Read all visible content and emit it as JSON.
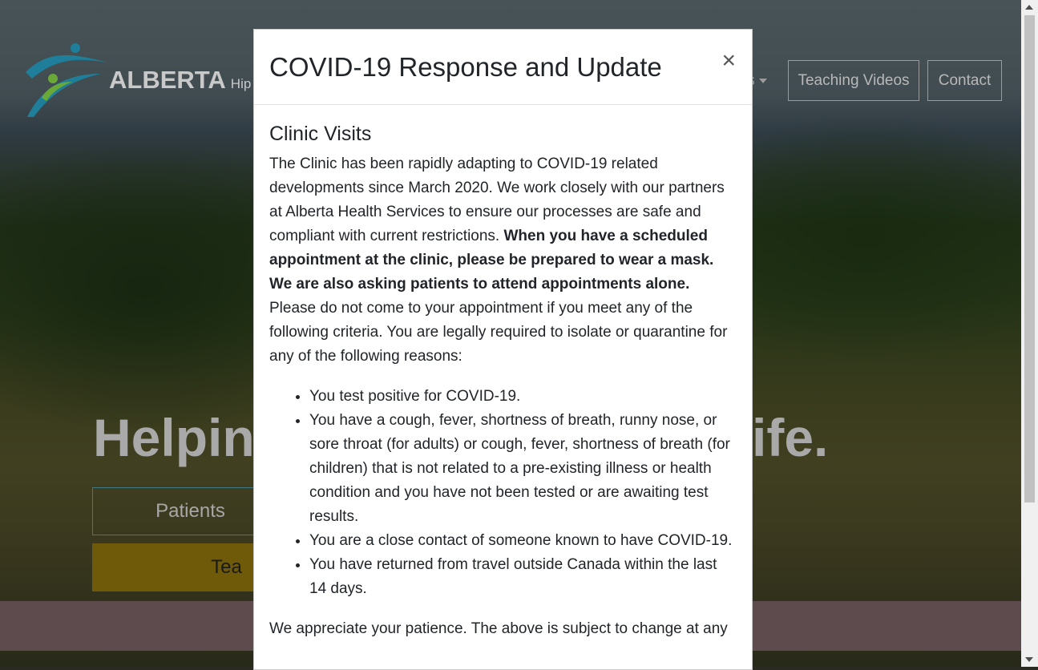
{
  "site": {
    "brand_name": "ALBERTA",
    "brand_sub": "Hip",
    "nav_partial_label": "ls",
    "nav_buttons": [
      "Teaching Videos",
      "Contact"
    ],
    "headline_start": "Helpin",
    "headline_end": "ife.",
    "hero_buttons": {
      "outline": "Patients",
      "solid": "Tea"
    }
  },
  "modal": {
    "title": "COVID-19 Response and Update",
    "close_label": "×",
    "section_title": "Clinic Visits",
    "intro_plain": "The Clinic has been rapidly adapting to COVID-19 related developments since March 2020. We work closely with our partners at Alberta Health Services to ensure our processes are safe and compliant with current restrictions.",
    "intro_bold": "When you have a scheduled appointment at the clinic, please be prepared to wear a mask. We are also asking patients to attend appointments alone.",
    "intro_tail": "Please do not come to your appointment if you meet any of the following criteria. You are legally required to isolate or quarantine for any of the following reasons:",
    "criteria": [
      "You test positive for COVID-19.",
      "You have a cough, fever, shortness of breath, runny nose, or sore throat (for adults) or cough, fever, shortness of breath (for children) that is not related to a pre-existing illness or health condition and you have not been tested or are awaiting test results.",
      "You are a close contact of someone known to have COVID-19.",
      "You have returned from travel outside Canada within the last 14 days."
    ],
    "closing": "We appreciate your patience. The above is subject to change at any"
  },
  "colors": {
    "overlay": "#000000",
    "modal_bg": "#ffffff",
    "hero_solid_button": "#6e5a09",
    "band": "#5e4b4d",
    "logo_teal": "#1f7f9a",
    "logo_green": "#6aa837"
  },
  "icons": {
    "logo": "runner-logo-icon",
    "close": "close-icon",
    "dropdown": "caret-down-icon"
  }
}
